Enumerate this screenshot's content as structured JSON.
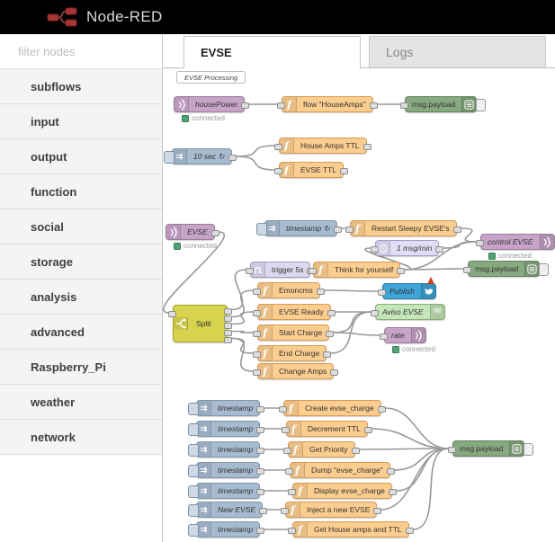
{
  "header": {
    "title": "Node-RED"
  },
  "sidebar": {
    "filter_placeholder": "filter nodes",
    "categories": [
      "subflows",
      "input",
      "output",
      "function",
      "social",
      "storage",
      "analysis",
      "advanced",
      "Raspberry_Pi",
      "weather",
      "network"
    ]
  },
  "tabs": [
    {
      "label": "EVSE",
      "active": true
    },
    {
      "label": "Logs",
      "active": false
    }
  ],
  "flow": {
    "status_connected_label": "connected",
    "nodes": [
      {
        "id": "comment",
        "label": "EVSE Processing",
        "type": "comment",
        "italic": true
      },
      {
        "id": "housePower",
        "label": "housePower",
        "type": "mqtt-in",
        "italic": true,
        "status": "connected"
      },
      {
        "id": "flowHouseAmps",
        "label": "flow \"HouseAmps\"",
        "type": "function"
      },
      {
        "id": "msgTop",
        "label": "msg.payload",
        "type": "debug"
      },
      {
        "id": "tenSec",
        "label": "10 sec ↻",
        "type": "inject",
        "italic": true
      },
      {
        "id": "houseAmpsTTL",
        "label": "House Amps TTL",
        "type": "function"
      },
      {
        "id": "evseTTL",
        "label": "EVSE TTL",
        "type": "function"
      },
      {
        "id": "evse",
        "label": "EVSE",
        "type": "mqtt-in",
        "italic": true,
        "status": "connected"
      },
      {
        "id": "tsMid",
        "label": "timestamp ↻",
        "type": "inject",
        "italic": true
      },
      {
        "id": "restart",
        "label": "Restart Sleepy EVSE's",
        "type": "function"
      },
      {
        "id": "msgmin",
        "label": "1 msg/min",
        "type": "delay",
        "italic": true
      },
      {
        "id": "controlEVSE",
        "label": "control EVSE",
        "type": "mqtt-out",
        "italic": true,
        "status": "connected"
      },
      {
        "id": "trigger5s",
        "label": "trigger 5s",
        "type": "trigger"
      },
      {
        "id": "think",
        "label": "Think for yourself",
        "type": "function"
      },
      {
        "id": "msgMid",
        "label": "msg.payload",
        "type": "debug"
      },
      {
        "id": "emoncms",
        "label": "Emoncms",
        "type": "function"
      },
      {
        "id": "publish",
        "label": "Publish",
        "type": "twitter",
        "italic": true,
        "error": true
      },
      {
        "id": "split",
        "label": "Split",
        "type": "switch"
      },
      {
        "id": "evseReady",
        "label": "EVSE Ready",
        "type": "function"
      },
      {
        "id": "aviso",
        "label": "Aviso EVSE",
        "type": "email",
        "italic": true
      },
      {
        "id": "startCharge",
        "label": "Start Charge",
        "type": "function"
      },
      {
        "id": "rate",
        "label": "rate",
        "type": "mqtt-out",
        "italic": true,
        "status": "connected"
      },
      {
        "id": "endCharge",
        "label": "End Charge",
        "type": "function"
      },
      {
        "id": "changeAmps",
        "label": "Change Amps",
        "type": "function"
      },
      {
        "id": "ts1",
        "label": "timestamp",
        "type": "inject",
        "italic": true
      },
      {
        "id": "ts2",
        "label": "timestamp",
        "type": "inject",
        "italic": true
      },
      {
        "id": "ts3",
        "label": "timestamp",
        "type": "inject",
        "italic": true
      },
      {
        "id": "ts4",
        "label": "timestamp",
        "type": "inject",
        "italic": true
      },
      {
        "id": "ts5",
        "label": "timestamp",
        "type": "inject",
        "italic": true
      },
      {
        "id": "ts6",
        "label": "New EVSE",
        "type": "inject",
        "italic": true
      },
      {
        "id": "ts7",
        "label": "timestamp",
        "type": "inject",
        "italic": true
      },
      {
        "id": "fn1",
        "label": "Create evse_charge",
        "type": "function"
      },
      {
        "id": "fn2",
        "label": "Decrement TTL",
        "type": "function"
      },
      {
        "id": "fn3",
        "label": "Get Priority",
        "type": "function"
      },
      {
        "id": "fn4",
        "label": "Dump \"evse_charge\"",
        "type": "function"
      },
      {
        "id": "fn5",
        "label": "Display evse_charge",
        "type": "function"
      },
      {
        "id": "fn6",
        "label": "Inject a new EVSE",
        "type": "function"
      },
      {
        "id": "fn7",
        "label": "Get House amps and TTL",
        "type": "function"
      },
      {
        "id": "msgBottom",
        "label": "msg.payload",
        "type": "debug"
      }
    ],
    "wires": [
      {
        "from": "housePower",
        "to": "flowHouseAmps"
      },
      {
        "from": "flowHouseAmps",
        "to": "msgTop"
      },
      {
        "from": "tenSec",
        "to": "houseAmpsTTL"
      },
      {
        "from": "tenSec",
        "to": "evseTTL"
      },
      {
        "from": "evse",
        "to": "split"
      },
      {
        "from": "tsMid",
        "to": "restart"
      },
      {
        "from": "restart",
        "to": "controlEVSE"
      },
      {
        "from": "msgmin",
        "to": "controlEVSE"
      },
      {
        "from": "think",
        "to": "controlEVSE"
      },
      {
        "from": "think",
        "to": "msgMid"
      },
      {
        "from": "think",
        "to": "msgmin"
      },
      {
        "from": "trigger5s",
        "to": "think"
      },
      {
        "from": "split",
        "port": 0,
        "to": "trigger5s"
      },
      {
        "from": "split",
        "port": 1,
        "to": "emoncms"
      },
      {
        "from": "split",
        "port": 2,
        "to": "evseReady"
      },
      {
        "from": "split",
        "port": 3,
        "to": "startCharge"
      },
      {
        "from": "split",
        "port": 4,
        "to": "endCharge"
      },
      {
        "from": "split",
        "port": 4,
        "to": "changeAmps"
      },
      {
        "from": "emoncms",
        "to": "publish"
      },
      {
        "from": "evseReady",
        "to": "aviso"
      },
      {
        "from": "startCharge",
        "to": "aviso"
      },
      {
        "from": "endCharge",
        "to": "aviso"
      },
      {
        "from": "startCharge",
        "to": "rate"
      },
      {
        "from": "ts1",
        "to": "fn1"
      },
      {
        "from": "ts2",
        "to": "fn2"
      },
      {
        "from": "ts3",
        "to": "fn3"
      },
      {
        "from": "ts4",
        "to": "fn4"
      },
      {
        "from": "ts5",
        "to": "fn5"
      },
      {
        "from": "ts6",
        "to": "fn6"
      },
      {
        "from": "ts7",
        "to": "fn7"
      },
      {
        "from": "fn1",
        "to": "msgBottom"
      },
      {
        "from": "fn2",
        "to": "msgBottom"
      },
      {
        "from": "fn3",
        "to": "msgBottom"
      },
      {
        "from": "fn4",
        "to": "msgBottom"
      },
      {
        "from": "fn5",
        "to": "msgBottom"
      },
      {
        "from": "fn6",
        "to": "msgBottom"
      },
      {
        "from": "fn7",
        "to": "msgBottom"
      }
    ],
    "icons": {
      "mqtt": "signal-waves",
      "inject": "double-arrow",
      "function": "italic-f",
      "debug": "list-box",
      "delay": "clock",
      "trigger": "square-wave",
      "switch": "fork",
      "twitter": "bird",
      "email": "envelope"
    }
  },
  "colors": {
    "header_bg": "#000000",
    "mqtt": "#c7a4c7",
    "inject": "#a6bbcf",
    "function": "#fbcd8f",
    "debug": "#87a980",
    "delay": "#e2dcf5",
    "trigger": "#dcd7ec",
    "switch": "#d7d34f",
    "twitter": "#3fa4d7",
    "email": "#c4e6b8",
    "comment": "#ffffff",
    "wire": "#999999",
    "error_badge": "#d2421f",
    "status_dot": "#4fa372",
    "logo_red": "#a93434"
  }
}
